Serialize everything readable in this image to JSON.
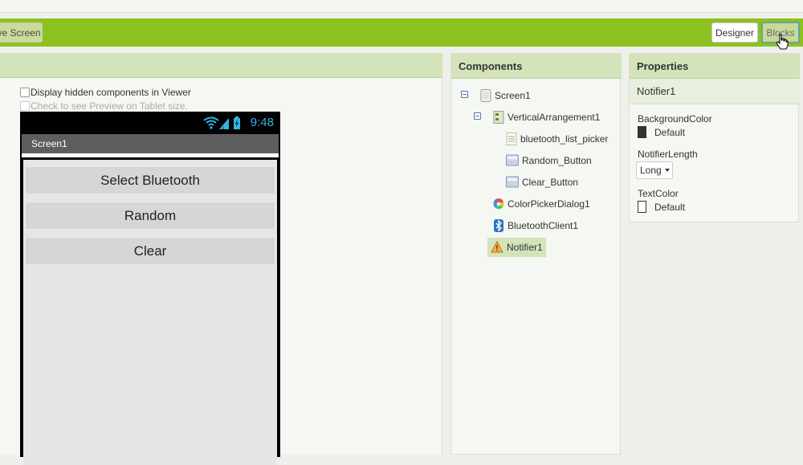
{
  "toolbar": {
    "remove_screen_label": "ve Screen",
    "designer_label": "Designer",
    "blocks_label": "Blocks"
  },
  "viewer": {
    "hidden_components_label": "Display hidden components in Viewer",
    "tablet_preview_label": "Check to see Preview on Tablet size.",
    "phone": {
      "clock": "9:48",
      "screen_title": "Screen1",
      "buttons": [
        "Select Bluetooth",
        "Random",
        "Clear"
      ]
    }
  },
  "components": {
    "title": "Components",
    "items": [
      {
        "label": "Screen1",
        "icon": "screen-icon"
      },
      {
        "label": "VerticalArrangement1",
        "icon": "vertical-arrangement-icon"
      },
      {
        "label": "bluetooth_list_picker",
        "icon": "list-picker-icon"
      },
      {
        "label": "Random_Button",
        "icon": "button-icon"
      },
      {
        "label": "Clear_Button",
        "icon": "button-icon"
      },
      {
        "label": "ColorPickerDialog1",
        "icon": "color-wheel-icon"
      },
      {
        "label": "BluetoothClient1",
        "icon": "bluetooth-icon"
      },
      {
        "label": "Notifier1",
        "icon": "warning-icon"
      }
    ],
    "selected": "Notifier1"
  },
  "properties": {
    "title": "Properties",
    "component_name": "Notifier1",
    "background_color": {
      "label": "BackgroundColor",
      "value": "Default",
      "swatch": "#333333"
    },
    "notifier_length": {
      "label": "NotifierLength",
      "value": "Long"
    },
    "text_color": {
      "label": "TextColor",
      "value": "Default",
      "swatch": "#ffffff"
    }
  },
  "colors": {
    "accent_green": "#8cc11f",
    "panel_header": "#d3e3ba",
    "clock_blue": "#33b5e5"
  }
}
